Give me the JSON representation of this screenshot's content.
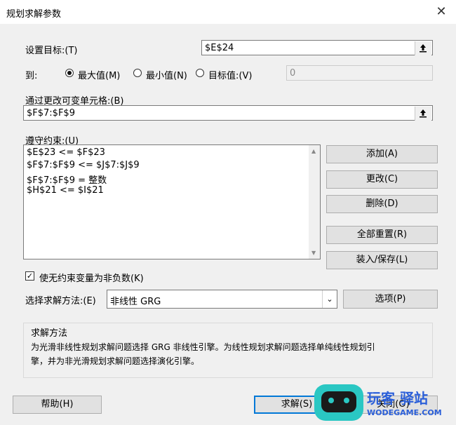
{
  "window": {
    "title": "规划求解参数",
    "close_icon": "close-icon"
  },
  "objective": {
    "label": "设置目标:(T)",
    "value": "$E$24",
    "ref_icon": "collapse-dialog-icon"
  },
  "to": {
    "label": "到:",
    "options": [
      {
        "label": "最大值(M)",
        "selected": true
      },
      {
        "label": "最小值(N)",
        "selected": false
      },
      {
        "label": "目标值:(V)",
        "selected": false
      }
    ],
    "value_of": "0"
  },
  "changing": {
    "label": "通过更改可变单元格:(B)",
    "value": "$F$7:$F$9",
    "ref_icon": "collapse-dialog-icon"
  },
  "constraints": {
    "label": "遵守约束:(U)",
    "items": [
      "$E$23 <= $F$23",
      "$F$7:$F$9 <= $J$7:$J$9",
      "$F$7:$F$9 = 整数",
      "$H$21 <= $I$21"
    ]
  },
  "buttons": {
    "add": "添加(A)",
    "change": "更改(C)",
    "delete": "删除(D)",
    "reset_all": "全部重置(R)",
    "load_save": "装入/保存(L)",
    "options": "选项(P)",
    "help": "帮助(H)",
    "solve": "求解(S)",
    "close": "关闭(O)"
  },
  "nonneg": {
    "label": "使无约束变量为非负数(K)",
    "checked": true
  },
  "method": {
    "label": "选择求解方法:(E)",
    "value": "非线性 GRG"
  },
  "solving_method": {
    "title": "求解方法",
    "line1": "为光滑非线性规划求解问题选择 GRG 非线性引擎。为线性规划求解问题选择单纯线性规划引",
    "line2": "擎，并为非光滑规划求解问题选择演化引擎。"
  },
  "watermark": {
    "cn": "玩客 驿站",
    "en": "WODEGAME.COM"
  }
}
